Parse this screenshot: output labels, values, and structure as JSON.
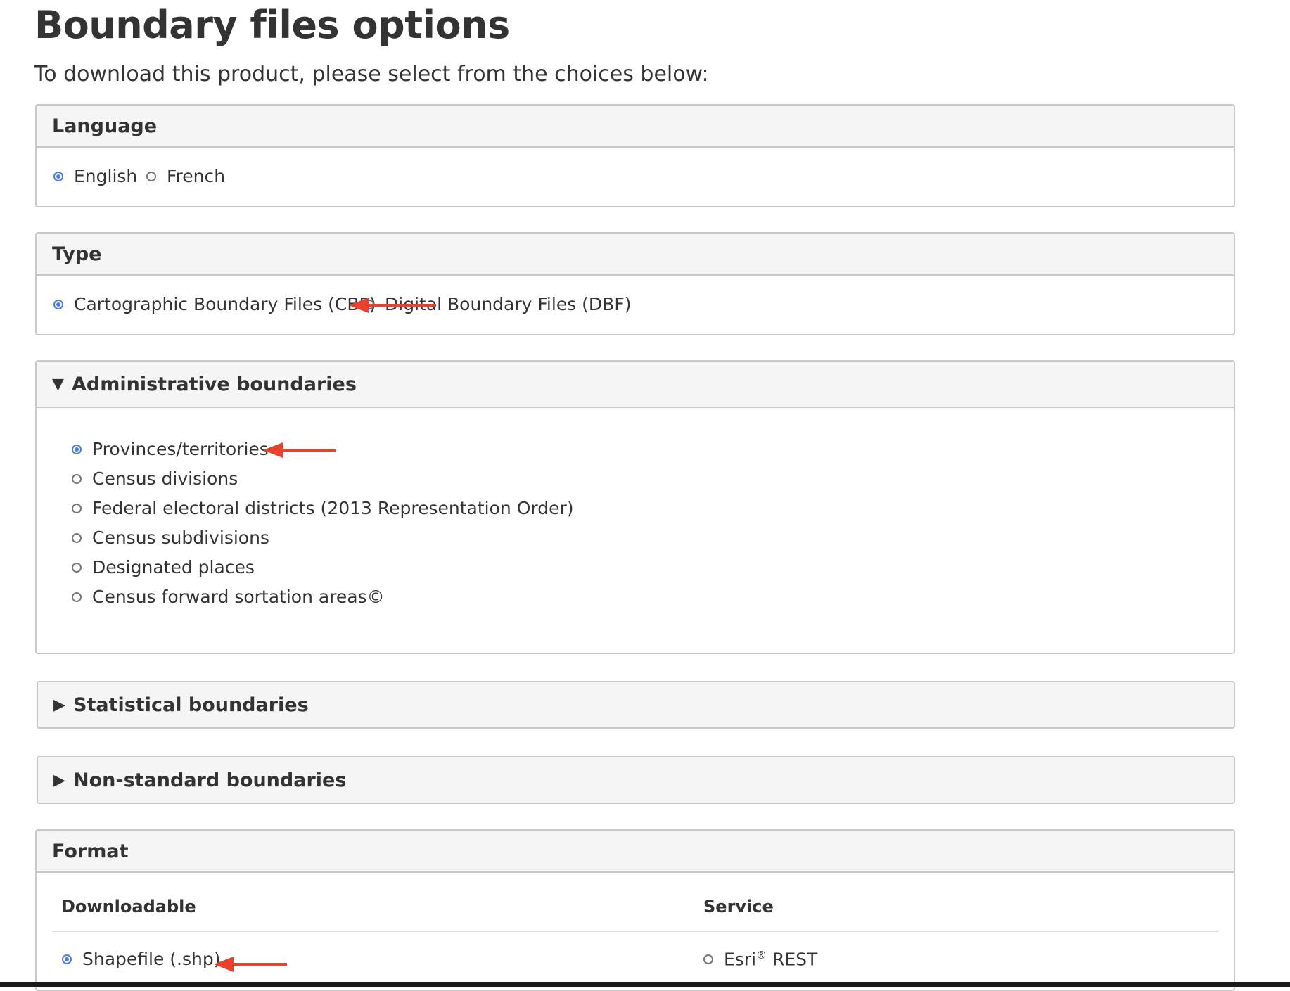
{
  "page": {
    "title": "Boundary files options",
    "intro": "To download this product, please select from the choices below:"
  },
  "language": {
    "heading": "Language",
    "options": [
      {
        "label": "English",
        "selected": true
      },
      {
        "label": "French",
        "selected": false
      }
    ]
  },
  "type": {
    "heading": "Type",
    "options": [
      {
        "label": "Cartographic Boundary Files (CBF)",
        "selected": true
      },
      {
        "label": "Digital Boundary Files (DBF)",
        "selected": false
      }
    ]
  },
  "administrative": {
    "heading": "Administrative boundaries",
    "expanded": true,
    "options": [
      {
        "label": "Provinces/territories",
        "selected": true
      },
      {
        "label": "Census divisions",
        "selected": false
      },
      {
        "label": "Federal electoral districts (2013 Representation Order)",
        "selected": false
      },
      {
        "label": "Census subdivisions",
        "selected": false
      },
      {
        "label": "Designated places",
        "selected": false
      },
      {
        "label": "Census forward sortation areas©",
        "selected": false
      }
    ]
  },
  "statistical": {
    "heading": "Statistical boundaries",
    "expanded": false
  },
  "nonstandard": {
    "heading": "Non-standard boundaries",
    "expanded": false
  },
  "format": {
    "heading": "Format",
    "downloadable_heading": "Downloadable",
    "service_heading": "Service",
    "downloadable_options": [
      {
        "label": "Shapefile (.shp)",
        "selected": true
      }
    ],
    "service_options": [
      {
        "label_main": "Esri",
        "label_sup": "®",
        "label_rest": " REST",
        "selected": false
      }
    ]
  },
  "icons": {
    "expanded": "triangle-down-icon",
    "collapsed": "triangle-right-icon",
    "annotation": "red-arrow-icon"
  },
  "colors": {
    "accent": "#4a7de2",
    "annotation": "#e8412c",
    "panel_header_bg": "#f5f5f5",
    "border": "#c8c8c8"
  }
}
